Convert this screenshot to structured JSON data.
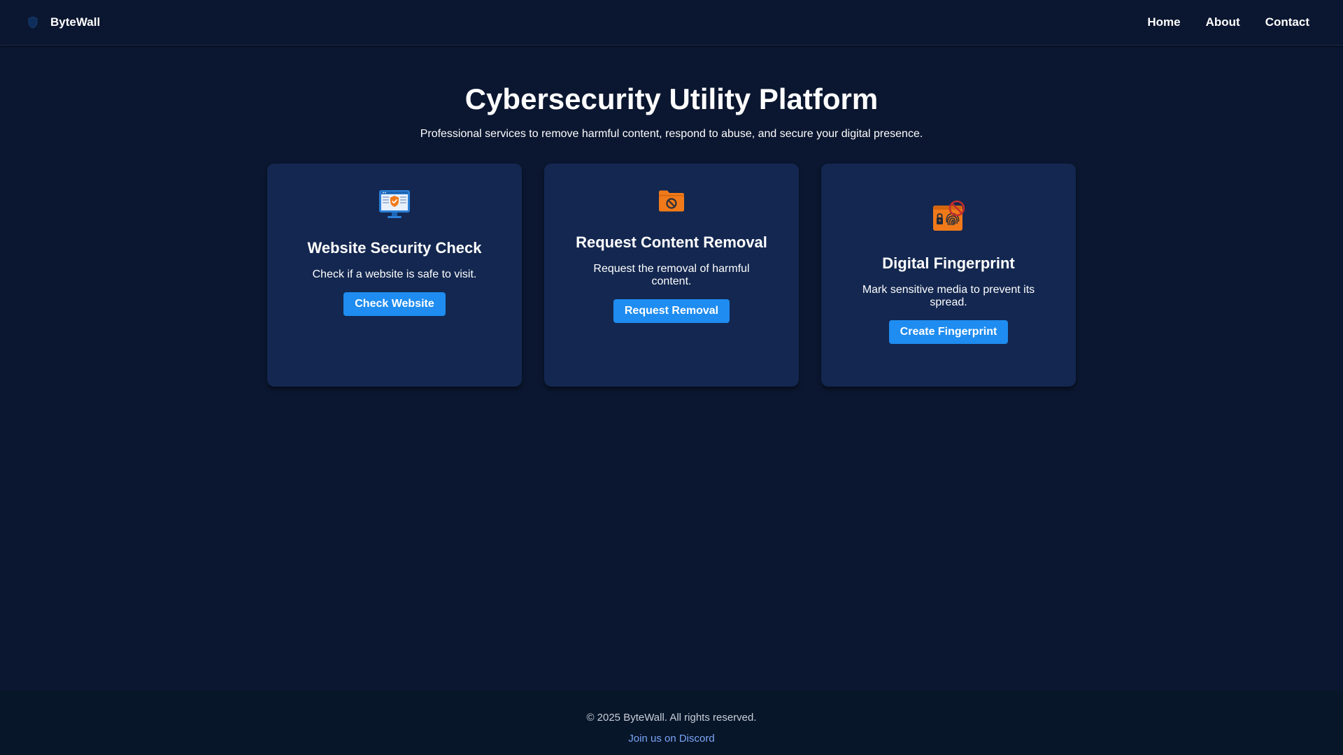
{
  "header": {
    "brand_name": "ByteWall",
    "logo_icon": "shield-logo-icon",
    "nav": [
      {
        "label": "Home"
      },
      {
        "label": "About"
      },
      {
        "label": "Contact"
      }
    ]
  },
  "hero": {
    "title": "Cybersecurity Utility Platform",
    "subtitle": "Professional services to remove harmful content, respond to abuse, and secure your digital presence."
  },
  "cards": [
    {
      "icon": "monitor-shield-icon",
      "title": "Website Security Check",
      "description": "Check if a website is safe to visit.",
      "button_label": "Check Website"
    },
    {
      "icon": "folder-blocked-icon",
      "title": "Request Content Removal",
      "description": "Request the removal of harmful content.",
      "button_label": "Request Removal"
    },
    {
      "icon": "fingerprint-lock-icon",
      "title": "Digital Fingerprint",
      "description": "Mark sensitive media to prevent its spread.",
      "button_label": "Create Fingerprint"
    }
  ],
  "footer": {
    "copyright": "© 2025 ByteWall. All rights reserved.",
    "discord_link": "Join us on Discord"
  },
  "colors": {
    "background": "#0b1730",
    "card": "#132750",
    "accent_button": "#1e8cf0",
    "icon_orange": "#f07a1a",
    "icon_blue": "#2a7fd8",
    "footer": "#08162a",
    "link": "#7aa5f5"
  }
}
